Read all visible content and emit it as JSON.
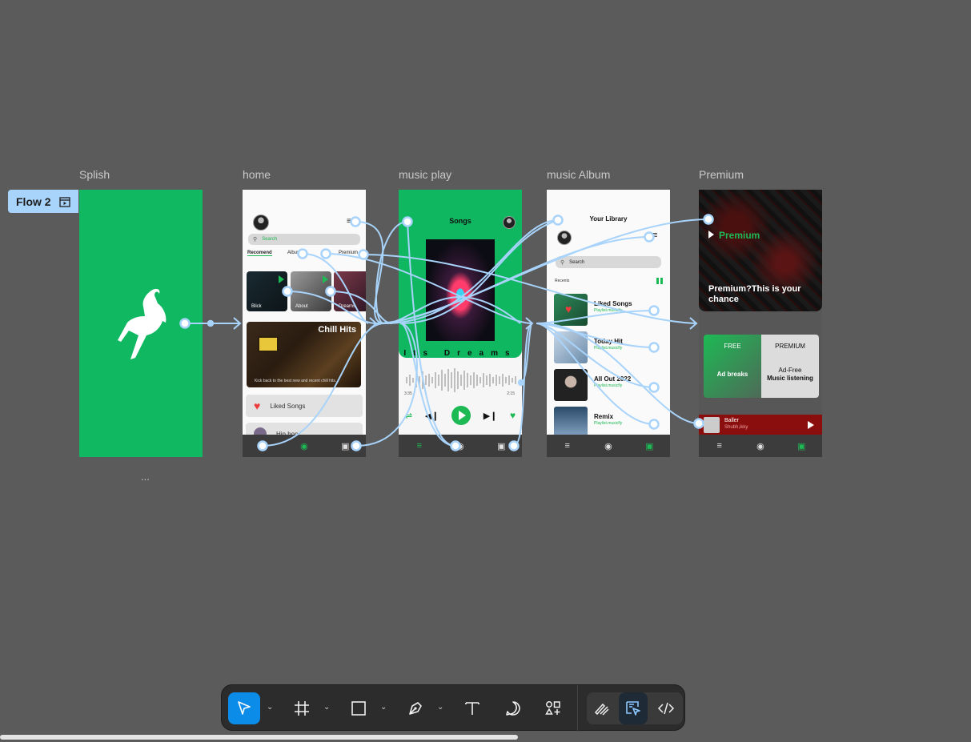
{
  "flow_tag": {
    "label": "Flow 2"
  },
  "frames": {
    "splish": {
      "label": "Splish"
    },
    "home": {
      "label": "home"
    },
    "music_play": {
      "label": "music play"
    },
    "music_album": {
      "label": "music Album"
    },
    "premium": {
      "label": "Premium"
    }
  },
  "ellipsis": "...",
  "home": {
    "search_placeholder": "Search",
    "tabs": [
      "Recomend",
      "Album",
      "Premium"
    ],
    "thumbs": [
      "Blick",
      "About",
      "Dreams"
    ],
    "big_card_title": "Chill Hits",
    "big_card_sub": "Kick back to the best new and recent chill hits.",
    "rows": [
      "Liked Songs",
      "Hip hop"
    ]
  },
  "music_play": {
    "title": "Songs",
    "track_word": "Its Dreams",
    "time_elapsed": "3:35",
    "time_total": "2:15"
  },
  "music_album": {
    "title": "Your Library",
    "search_placeholder": "Search",
    "recents_label": "Recents",
    "items": [
      {
        "name": "Liked Songs",
        "sub": "Playlist.musicfly"
      },
      {
        "name": "Today Hit",
        "sub": "Playlist.musicfly"
      },
      {
        "name": "All Out 2022",
        "sub": "Playlist.musicfly"
      },
      {
        "name": "Remix",
        "sub": "Playlist.musicfly"
      }
    ]
  },
  "premium": {
    "label": "Premium",
    "headline": "Premium?This is your chance",
    "free_header": "FREE",
    "free_body": "Ad breaks",
    "premium_header": "PREMIUM",
    "premium_body_1": "Ad-Free",
    "premium_body_2": "Music listening",
    "player_title": "Baller",
    "player_artist": "Shubh,ikky"
  },
  "colors": {
    "canvas": "#5b5b5b",
    "brand_green": "#1db954",
    "splash_green": "#10b862",
    "flow_wire": "#a8d3fa",
    "toolbar_active": "#0c8ce9"
  },
  "toolbar": {
    "tools": [
      "move-icon",
      "frame-icon",
      "rectangle-icon",
      "pen-icon",
      "text-icon",
      "comment-icon",
      "actions-icon"
    ],
    "modes": [
      "draw-mode-icon",
      "design-mode-icon",
      "dev-mode-icon"
    ]
  }
}
